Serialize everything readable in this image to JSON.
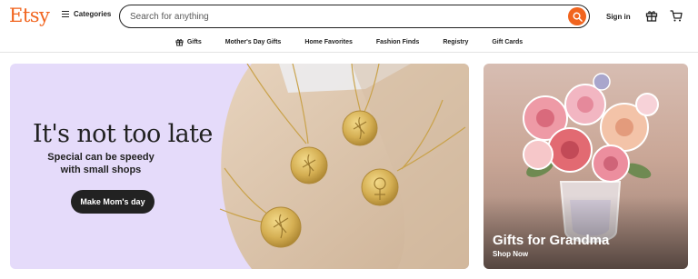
{
  "header": {
    "logo": "Etsy",
    "categories_label": "Categories",
    "search_placeholder": "Search for anything",
    "signin_label": "Sign in",
    "icons": [
      "menu-icon",
      "search-icon",
      "gift-icon",
      "cart-icon"
    ],
    "accent_color": "#f1641e"
  },
  "subnav": {
    "items": [
      {
        "label": "Gifts",
        "icon": "gift-icon"
      },
      {
        "label": "Mother's Day Gifts"
      },
      {
        "label": "Home Favorites"
      },
      {
        "label": "Fashion Finds"
      },
      {
        "label": "Registry"
      },
      {
        "label": "Gift Cards"
      }
    ]
  },
  "hero": {
    "title": "It's not too late",
    "subtitle_line1": "Special can be speedy",
    "subtitle_line2": "with small shops",
    "cta": "Make Mom's day",
    "background_color": "#e5dbfa"
  },
  "side_card": {
    "title": "Gifts for Grandma",
    "cta": "Shop Now"
  }
}
